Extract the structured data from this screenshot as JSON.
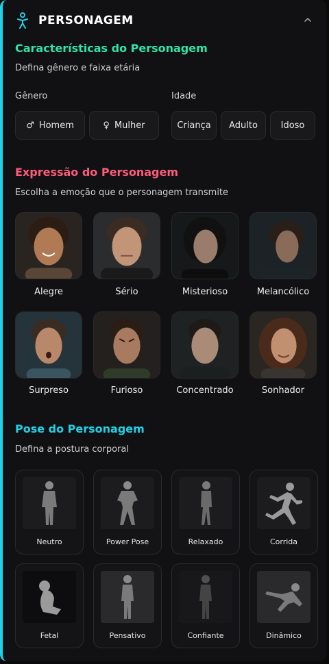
{
  "header": {
    "title": "PERSONAGEM",
    "icon": "person-icon",
    "accent": "#1fd1e6"
  },
  "characteristics": {
    "title": "Características do Personagem",
    "subtitle": "Defina gênero e faixa etária",
    "title_color": "#2ee6a6",
    "gender_label": "Gênero",
    "age_label": "Idade",
    "genders": [
      {
        "label": "Homem",
        "icon": "male-symbol-icon",
        "glyph": "♂"
      },
      {
        "label": "Mulher",
        "icon": "female-symbol-icon",
        "glyph": "♀"
      }
    ],
    "ages": [
      "Criança",
      "Adulto",
      "Idoso"
    ]
  },
  "expression": {
    "title": "Expressão do Personagem",
    "subtitle": "Escolha a emoção que o personagem transmite",
    "title_color": "#ff5c7a",
    "items": [
      "Alegre",
      "Sério",
      "Misterioso",
      "Melancólico",
      "Surpreso",
      "Furioso",
      "Concentrado",
      "Sonhador"
    ]
  },
  "pose": {
    "title": "Pose do Personagem",
    "subtitle": "Defina a postura corporal",
    "title_color": "#1fd1e6",
    "items": [
      "Neutro",
      "Power Pose",
      "Relaxado",
      "Corrida",
      "Fetal",
      "Pensativo",
      "Confiante",
      "Dinâmico"
    ]
  }
}
